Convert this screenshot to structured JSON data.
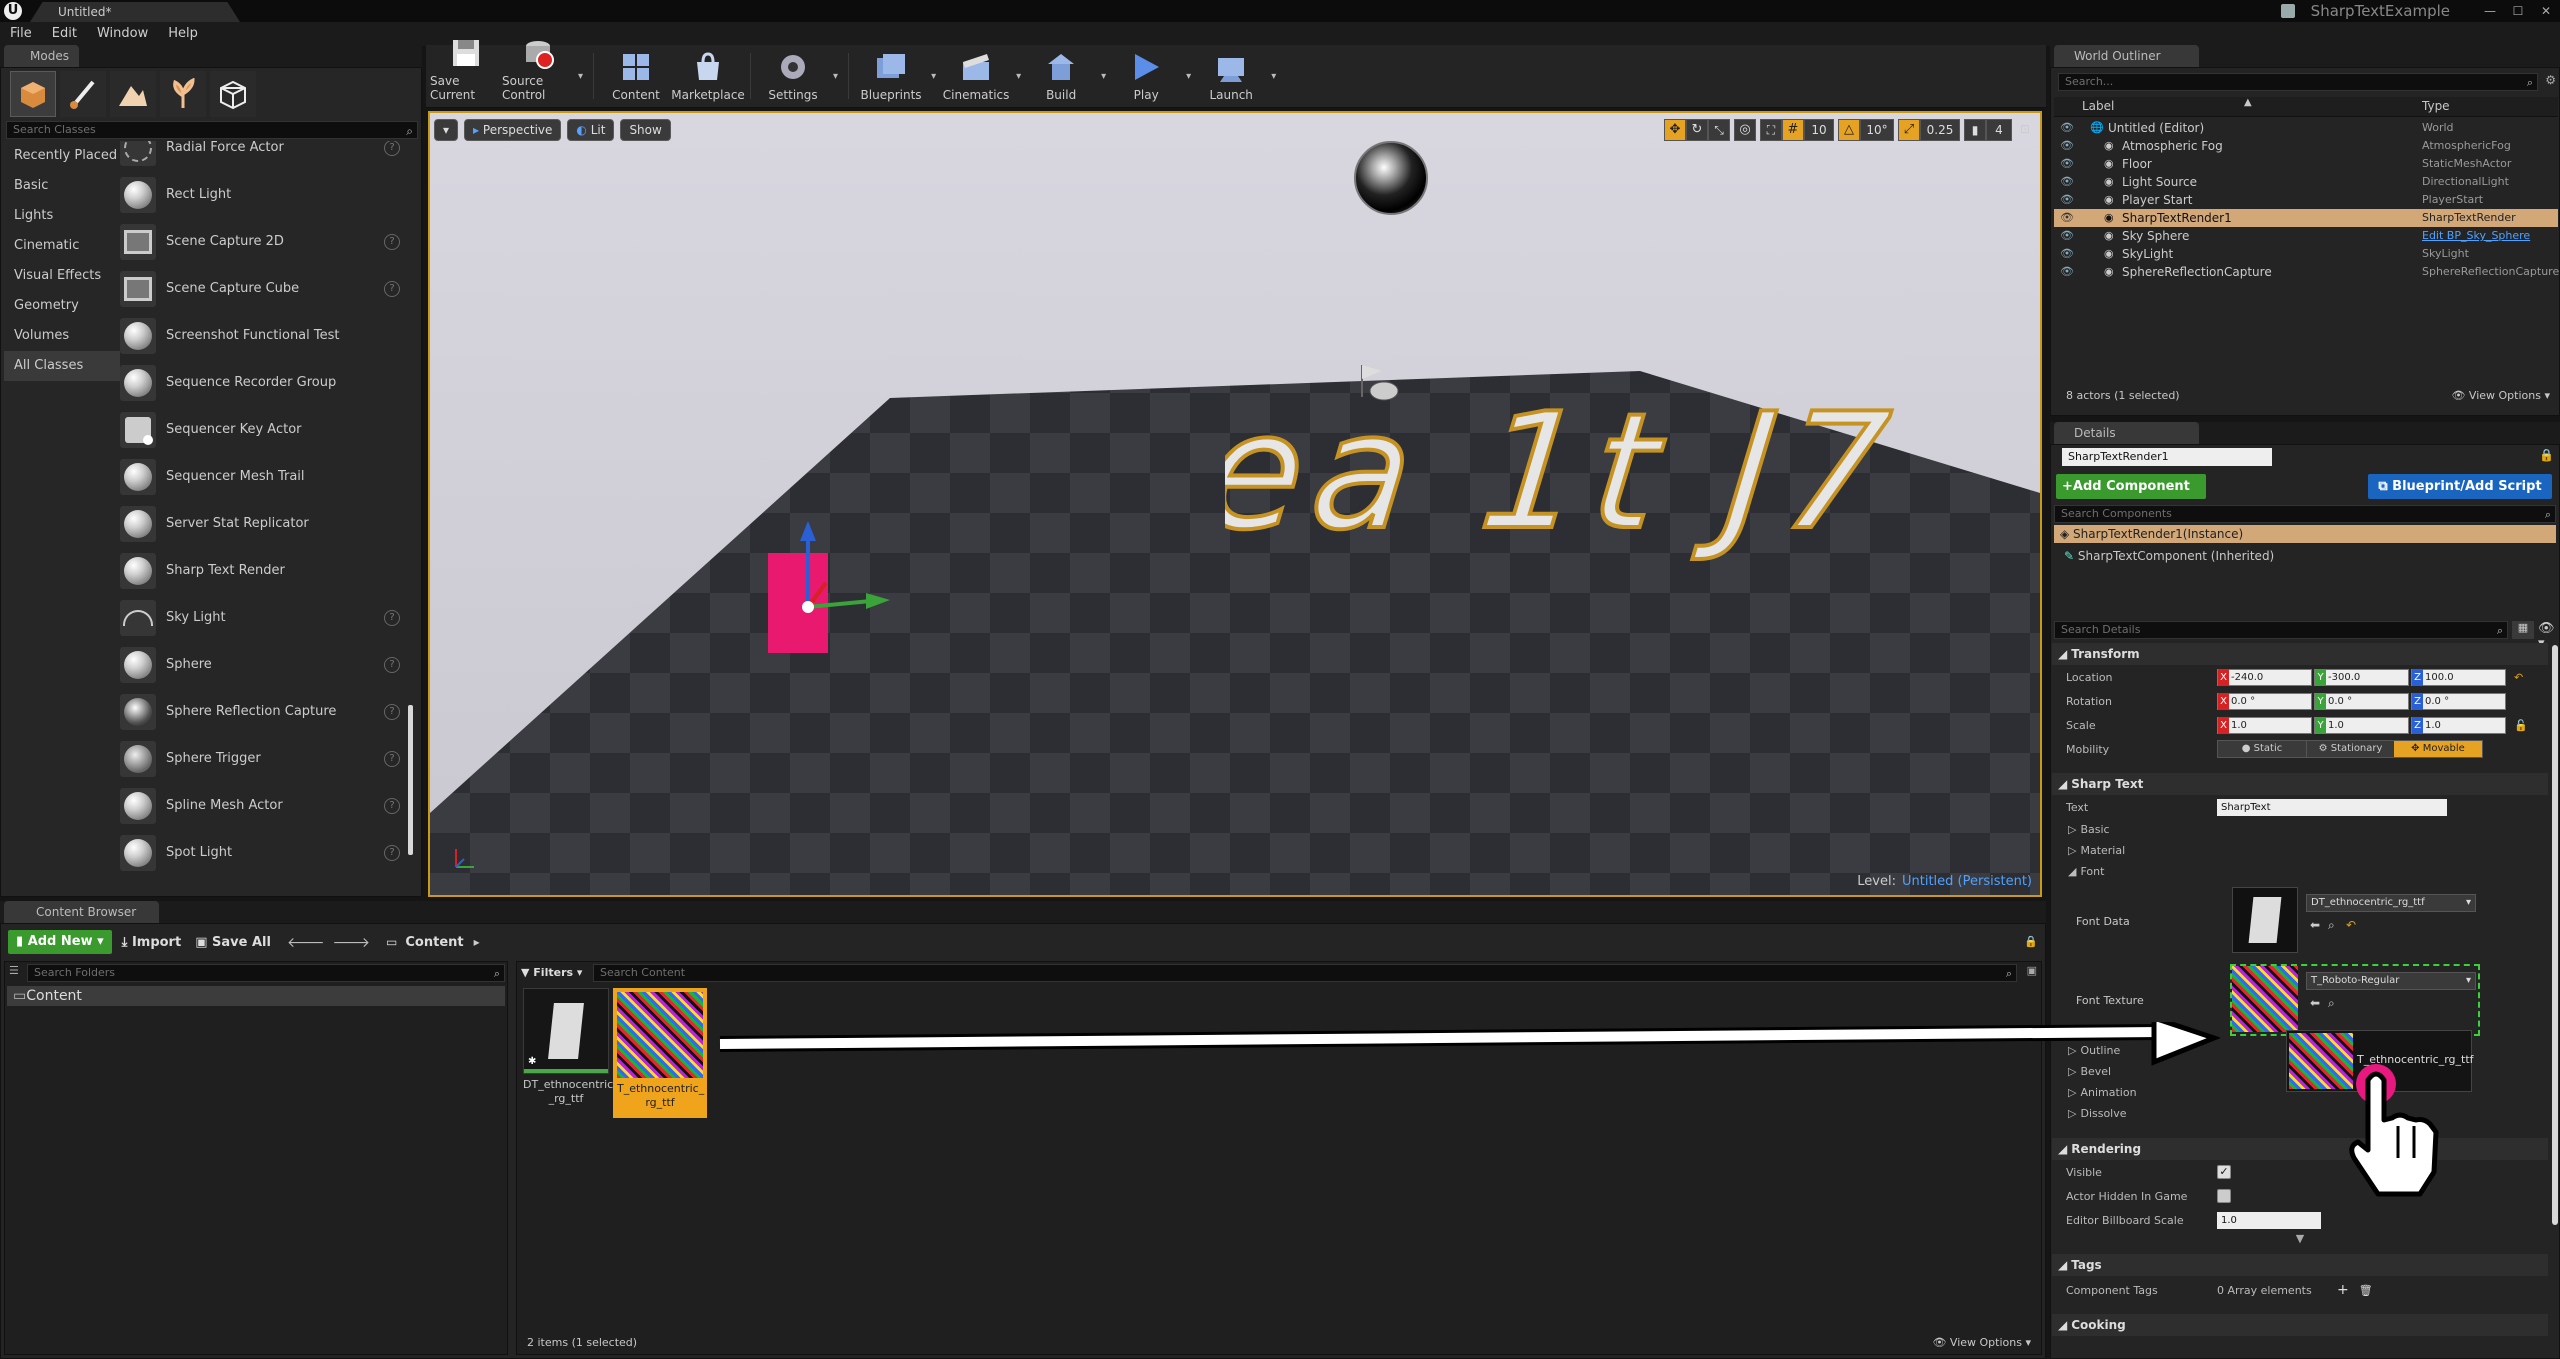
{
  "window": {
    "tab_title": "Untitled*",
    "project": "SharpTextExample"
  },
  "menu": [
    "File",
    "Edit",
    "Window",
    "Help"
  ],
  "modes": {
    "tab": "Modes",
    "search_placeholder": "Search Classes",
    "categories": [
      "Recently Placed",
      "Basic",
      "Lights",
      "Cinematic",
      "Visual Effects",
      "Geometry",
      "Volumes",
      "All Classes"
    ],
    "selected_category": "All Classes",
    "classes": [
      {
        "label": "Radial Force Actor",
        "icon": "radial-force-icon",
        "help": true
      },
      {
        "label": "Rect Light",
        "icon": "rect-light-icon",
        "help": false
      },
      {
        "label": "Scene Capture 2D",
        "icon": "scene-capture-2d-icon",
        "help": true
      },
      {
        "label": "Scene Capture Cube",
        "icon": "scene-capture-cube-icon",
        "help": true
      },
      {
        "label": "Screenshot Functional Test",
        "icon": "sphere-icon",
        "help": false
      },
      {
        "label": "Sequence Recorder Group",
        "icon": "sphere-icon",
        "help": false
      },
      {
        "label": "Sequencer Key Actor",
        "icon": "sequencer-key-icon",
        "help": false
      },
      {
        "label": "Sequencer Mesh Trail",
        "icon": "sphere-icon",
        "help": false
      },
      {
        "label": "Server Stat Replicator",
        "icon": "sphere-icon",
        "help": false
      },
      {
        "label": "Sharp Text Render",
        "icon": "sphere-icon",
        "help": false
      },
      {
        "label": "Sky Light",
        "icon": "sky-light-icon",
        "help": true
      },
      {
        "label": "Sphere",
        "icon": "sphere-icon",
        "help": true
      },
      {
        "label": "Sphere Reflection Capture",
        "icon": "reflection-capture-icon",
        "help": true
      },
      {
        "label": "Sphere Trigger",
        "icon": "sphere-trigger-icon",
        "help": true
      },
      {
        "label": "Spline Mesh Actor",
        "icon": "sphere-icon",
        "help": true
      },
      {
        "label": "Spot Light",
        "icon": "spot-light-icon",
        "help": true
      }
    ]
  },
  "toolbar": [
    {
      "label": "Save Current",
      "icon": "save-icon"
    },
    {
      "label": "Source Control",
      "icon": "source-control-icon"
    },
    {
      "label": "Content",
      "icon": "content-icon"
    },
    {
      "label": "Marketplace",
      "icon": "marketplace-icon"
    },
    {
      "label": "Settings",
      "icon": "settings-icon"
    },
    {
      "label": "Blueprints",
      "icon": "blueprints-icon"
    },
    {
      "label": "Cinematics",
      "icon": "cinematics-icon"
    },
    {
      "label": "Build",
      "icon": "build-icon"
    },
    {
      "label": "Play",
      "icon": "play-icon"
    },
    {
      "label": "Launch",
      "icon": "launch-icon"
    }
  ],
  "viewport": {
    "perspective": "Perspective",
    "lit": "Lit",
    "show": "Show",
    "grid_snap": "10",
    "rotation_snap": "10°",
    "scale_snap": "0.25",
    "camera_speed": "4",
    "level_label": "Level:",
    "level_name": "Untitled (Persistent)",
    "scene_text": "ea 1t J7"
  },
  "outliner": {
    "tab": "World Outliner",
    "search_placeholder": "Search...",
    "col_label": "Label",
    "col_type": "Type",
    "rows": [
      {
        "label": "Untitled (Editor)",
        "type": "World",
        "indent": 0,
        "selected": false,
        "link": false
      },
      {
        "label": "Atmospheric Fog",
        "type": "AtmosphericFog",
        "indent": 1,
        "selected": false,
        "link": false
      },
      {
        "label": "Floor",
        "type": "StaticMeshActor",
        "indent": 1,
        "selected": false,
        "link": false
      },
      {
        "label": "Light Source",
        "type": "DirectionalLight",
        "indent": 1,
        "selected": false,
        "link": false
      },
      {
        "label": "Player Start",
        "type": "PlayerStart",
        "indent": 1,
        "selected": false,
        "link": false
      },
      {
        "label": "SharpTextRender1",
        "type": "SharpTextRender",
        "indent": 1,
        "selected": true,
        "link": false
      },
      {
        "label": "Sky Sphere",
        "type": "Edit BP_Sky_Sphere",
        "indent": 1,
        "selected": false,
        "link": true
      },
      {
        "label": "SkyLight",
        "type": "SkyLight",
        "indent": 1,
        "selected": false,
        "link": false
      },
      {
        "label": "SphereReflectionCapture",
        "type": "SphereReflectionCapture",
        "indent": 1,
        "selected": false,
        "link": false
      }
    ],
    "footer_count": "8 actors (1 selected)",
    "view_options": "View Options"
  },
  "details": {
    "tab": "Details",
    "actor_name": "SharpTextRender1",
    "add_component": "+Add Component",
    "blueprint": "Blueprint/Add Script",
    "search_components": "Search Components",
    "instance": "SharpTextRender1(Instance)",
    "component": "SharpTextComponent (Inherited)",
    "search_details": "Search Details",
    "transform": {
      "title": "Transform",
      "location_label": "Location",
      "location": [
        "-240.0",
        "-300.0",
        "100.0"
      ],
      "rotation_label": "Rotation",
      "rotation": [
        "0.0 °",
        "0.0 °",
        "0.0 °"
      ],
      "scale_label": "Scale",
      "scale": [
        "1.0",
        "1.0",
        "1.0"
      ],
      "mobility_label": "Mobility",
      "mobility": [
        "Static",
        "Stationary",
        "Movable"
      ],
      "mobility_selected": "Movable"
    },
    "sharp_text": {
      "title": "Sharp Text",
      "text_label": "Text",
      "text_value": "SharpText",
      "basic": "Basic",
      "material": "Material",
      "font": "Font",
      "font_data_label": "Font Data",
      "font_data_value": "DT_ethnocentric_rg_ttf",
      "font_texture_label": "Font Texture",
      "font_texture_value": "T_Roboto-Regular",
      "drag_tooltip": "T_ethnocentric_rg_ttf",
      "outline": "Outline",
      "bevel": "Bevel",
      "animation": "Animation",
      "dissolve": "Dissolve"
    },
    "rendering": {
      "title": "Rendering",
      "visible": "Visible",
      "hidden_in_game": "Actor Hidden In Game",
      "billboard_scale": "Editor Billboard Scale",
      "billboard_value": "1.0"
    },
    "tags": {
      "title": "Tags",
      "component_tags": "Component Tags",
      "array": "0 Array elements"
    },
    "cooking": {
      "title": "Cooking"
    }
  },
  "content_browser": {
    "tab": "Content Browser",
    "add_new": "Add New",
    "import": "Import",
    "save_all": "Save All",
    "path": "Content",
    "search_folders": "Search Folders",
    "folder": "Content",
    "filters": "Filters",
    "search_content": "Search Content",
    "assets": [
      {
        "label": "DT_ethnocentric_rg_ttf",
        "line1": "DT_ethnocentric",
        "line2": "_rg_ttf",
        "selected": false
      },
      {
        "label": "T_ethnocentric_rg_ttf",
        "line1": "T_ethnocentric_",
        "line2": "rg_ttf",
        "selected": true
      }
    ],
    "status": "2 items (1 selected)",
    "view_options": "View Options"
  },
  "colors": {
    "accent": "#f5a524",
    "selection": "#d3a878",
    "add_green": "#3a9a2d",
    "blueprint_blue": "#1a65c0",
    "pink_drop": "#e8197e",
    "vx": "#d62222",
    "vy": "#3aa33a",
    "vz": "#2a5fd6"
  }
}
